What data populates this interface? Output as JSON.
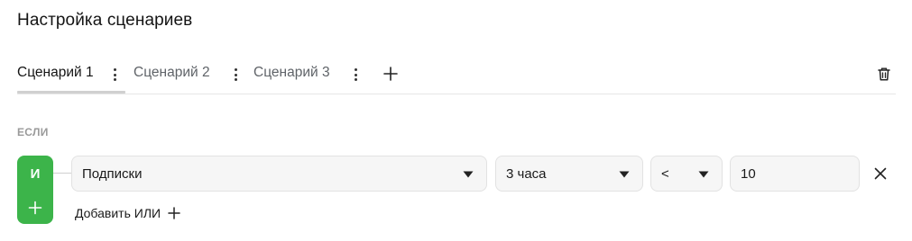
{
  "page": {
    "title": "Настройка сценариев"
  },
  "tabs": [
    {
      "label": "Сценарий 1",
      "active": true
    },
    {
      "label": "Сценарий 2",
      "active": false
    },
    {
      "label": "Сценарий 3",
      "active": false
    }
  ],
  "icons": {
    "tab_menu": "vertical-dots-icon",
    "add_tab": "plus-icon",
    "delete": "trash-icon",
    "remove_condition": "close-icon",
    "dropdown": "caret-down-icon"
  },
  "condition": {
    "section_label": "ЕСЛИ",
    "logic_operator": "И",
    "metric": "Подписки",
    "period": "3 часа",
    "comparison": "<",
    "value": "10",
    "add_or_label": "Добавить ИЛИ"
  },
  "colors": {
    "accent": "#3cb44a"
  }
}
